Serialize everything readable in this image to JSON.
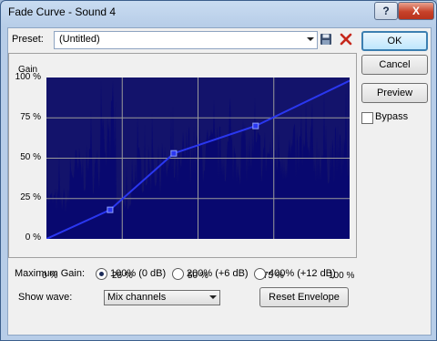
{
  "window": {
    "title": "Fade Curve - Sound 4",
    "help_label": "?",
    "close_label": "X"
  },
  "preset": {
    "label": "Preset:",
    "value": "(Untitled)"
  },
  "icons": {
    "save": "save-floppy-icon",
    "delete": "delete-x-icon"
  },
  "buttons": {
    "ok": "OK",
    "cancel": "Cancel",
    "preview": "Preview",
    "reset_envelope": "Reset Envelope"
  },
  "bypass": {
    "label": "Bypass",
    "checked": false
  },
  "max_gain": {
    "label": "Maximum Gain:",
    "options": [
      {
        "label": "100% (0 dB)",
        "selected": true
      },
      {
        "label": "200% (+6 dB)",
        "selected": false
      },
      {
        "label": "400% (+12 dB)",
        "selected": false
      }
    ]
  },
  "show_wave": {
    "label": "Show wave:",
    "value": "Mix channels"
  },
  "chart_data": {
    "type": "line",
    "ylabel": "Gain",
    "xlabel": "",
    "x_ticks": [
      "0 %",
      "25 %",
      "50 %",
      "75 %",
      "100 %"
    ],
    "y_ticks": [
      "100 %",
      "75 %",
      "50 %",
      "25 %",
      "0 %"
    ],
    "xlim": [
      0,
      100
    ],
    "ylim": [
      0,
      100
    ],
    "grid": true,
    "series": [
      {
        "x": [
          0,
          21,
          42,
          69,
          100
        ],
        "y": [
          0,
          18,
          53,
          70,
          98
        ]
      }
    ],
    "colors": {
      "background": "#13136b",
      "wave": "#080870",
      "grid": "#9a9a9a",
      "envelope": "#2a37f0"
    }
  }
}
